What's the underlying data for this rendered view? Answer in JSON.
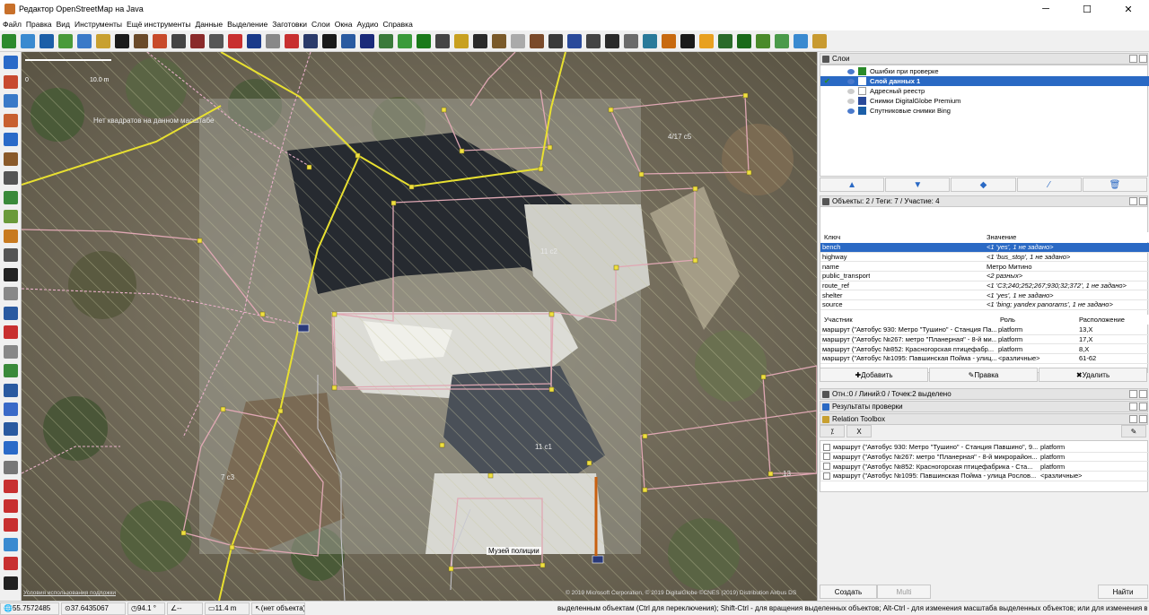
{
  "window": {
    "title": "Редактор OpenStreetMap на Java",
    "minimize": "─",
    "maximize": "☐",
    "close": "✕"
  },
  "menu": [
    "Файл",
    "Правка",
    "Вид",
    "Инструменты",
    "Ещё инструменты",
    "Данные",
    "Выделение",
    "Заготовки",
    "Слои",
    "Окна",
    "Аудио",
    "Справка"
  ],
  "toolbar_colors": [
    "#2d8a2d",
    "#3a8ad0",
    "#1c5fa8",
    "#4a9a3a",
    "#3a7ac8",
    "#c8a030",
    "#1a1a1a",
    "#6a4a2a",
    "#c84a2a",
    "#444",
    "#8a2a2a",
    "#555",
    "#c83030",
    "#1a3a8a",
    "#888",
    "#c83030",
    "#2a3a6a",
    "#1a1a1a",
    "#2a5aa0",
    "#1a2a7a",
    "#3a7a3a",
    "#3a9a3a",
    "#1a7a1a",
    "#444",
    "#c8a020",
    "#2a2a2a",
    "#7a5a2a",
    "#aaa",
    "#7a4a2a",
    "#3a3a3a",
    "#2a4a9a",
    "#444",
    "#2a2a2a",
    "#6a6a6a",
    "#2a7a9a",
    "#c86a10",
    "#1a1a1a",
    "#e8a020",
    "#2a6a2a",
    "#1a6a1a",
    "#4a8a2a",
    "#4a9a4a",
    "#3a8ad0",
    "#c89a30"
  ],
  "left_tool_colors": [
    "#2a6ac8",
    "#c84a30",
    "#3a7ac8",
    "#c86030",
    "#2a6ac8",
    "#8a5a2a",
    "#555",
    "#3a8a3a",
    "#6a9a3a",
    "#c87a20",
    "#555",
    "#222",
    "#888",
    "#2a5aa0",
    "#c83030",
    "#888",
    "#3a8a3a",
    "#2a5aa0",
    "#3a6ac8",
    "#2a5aa0",
    "#2a6ac8",
    "#777",
    "#c83030",
    "#c83030",
    "#c83030",
    "#3a8ad0",
    "#c83030",
    "#222"
  ],
  "map": {
    "scale_start": "0",
    "scale_end": "10.0 m",
    "no_imagery": "Нет квадратов на данном масштабе",
    "labels": [
      "4/17 с5",
      "11 с2",
      "11 с1",
      "7 с3",
      "13"
    ],
    "museum_label": "Музей полиции",
    "attribution": "© 2019 Microsoft Corporation, © 2019 DigitalGlobe ©CNES (2019) Distribution Airbus DS",
    "bing_terms": "Условия использования подложки"
  },
  "layers_panel": {
    "title": "Слои",
    "layers": [
      {
        "name": "Ошибки при проверке",
        "checked": false,
        "selected": false
      },
      {
        "name": "Слой данных 1",
        "checked": true,
        "selected": true
      },
      {
        "name": "Адресный реестр",
        "checked": false,
        "selected": false
      },
      {
        "name": "Снимки DigitalGlobe Premium",
        "checked": false,
        "selected": false
      },
      {
        "name": "Спутниковые снимки Bing",
        "checked": false,
        "selected": false
      }
    ],
    "buttons": [
      "▲",
      "▼",
      "◆",
      "⁄",
      "🗑"
    ]
  },
  "objects_panel": {
    "title": "Объекты: 2 / Теги: 7 / Участие: 4",
    "tag_headers": {
      "key": "Ключ",
      "value": "Значение"
    },
    "tags": [
      {
        "key": "bench",
        "value": "<1 'yes', 1 не задано>",
        "italic": true
      },
      {
        "key": "highway",
        "value": "<1 'bus_stop', 1 не задано>",
        "italic": true
      },
      {
        "key": "name",
        "value": "Метро Митино",
        "italic": false
      },
      {
        "key": "public_transport",
        "value": "<2 разных>",
        "italic": true
      },
      {
        "key": "route_ref",
        "value": "<1 'C3;240;252;267;930;32;372', 1 не задано>",
        "italic": true
      },
      {
        "key": "shelter",
        "value": "<1 'yes', 1 не задано>",
        "italic": true
      },
      {
        "key": "source",
        "value": "<1 'bing; yandex panorams', 1 не задано>",
        "italic": true
      }
    ],
    "member_headers": {
      "member": "Участник",
      "role": "Роль",
      "position": "Расположение"
    },
    "members": [
      {
        "name": "маршрут (\"Автобус 930: Метро \"Тушино\" - Станция Па...",
        "role": "platform",
        "pos": "13,X"
      },
      {
        "name": "маршрут (\"Автобус №267: метро \"Планерная\" - 8-й ми...",
        "role": "platform",
        "pos": "17,X"
      },
      {
        "name": "маршрут (\"Автобус №852: Красногорская птицефабр...",
        "role": "platform",
        "pos": "8,X"
      },
      {
        "name": "маршрут (\"Автобус №1095: Павшинская Пойма - улиц...",
        "role": "<различные>",
        "pos": "61-62"
      }
    ],
    "buttons": {
      "add": "Добавить",
      "edit": "Правка",
      "delete": "Удалить"
    }
  },
  "selection_panel": {
    "title": "Отн.:0 / Линий:0 / Точек:2 выделено"
  },
  "validation_panel": {
    "title": "Результаты проверки"
  },
  "relation_toolbox": {
    "title": "Relation Toolbox",
    "tool_buttons": [
      "⁒",
      "X"
    ],
    "rows": [
      {
        "name": "маршрут (\"Автобус 930: Метро \"Тушино\" - Станция Павшино\", 9...",
        "role": "platform"
      },
      {
        "name": "маршрут (\"Автобус №267: метро \"Планерная\" - 8-й микрорайон...",
        "role": "platform"
      },
      {
        "name": "маршрут (\"Автобус №852: Красногорская птицефабрика - Ста...",
        "role": "platform"
      },
      {
        "name": "маршрут (\"Автобус №1095: Павшинская Пойма - улица Рослов...",
        "role": "<различные>"
      }
    ],
    "create": "Создать",
    "multi": "Multi",
    "find": "Найти"
  },
  "status_bar": {
    "lat": "55.7572485",
    "lon": "37.6435067",
    "angle": "94.1 °",
    "heading": "--",
    "distance": "11.4 m",
    "object": "(нет объекта)",
    "help": "выделенным объектам (Ctrl для переключения); Shift-Ctrl - для вращения выделенных объектов; Alt-Ctrl - для изменения масштаба выделенных объектов; или для изменения выделения"
  },
  "colors": {
    "selection_blue": "#2a69c4",
    "way_yellow": "#e8e030",
    "way_pink": "#e0a0b0",
    "node_yellow": "#f0e040",
    "hatch": "#c8c8a0"
  }
}
